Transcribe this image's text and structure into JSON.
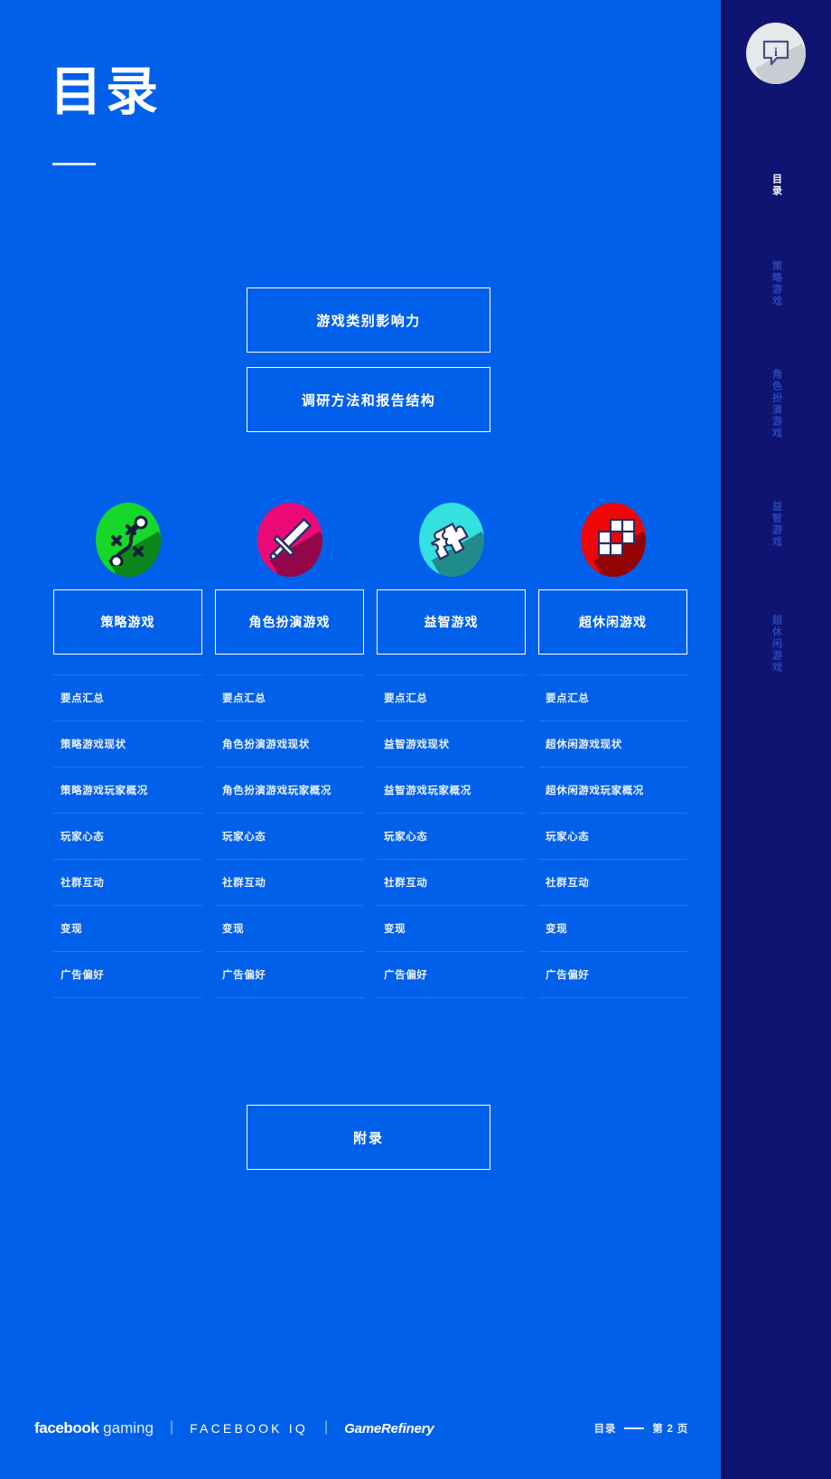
{
  "theme": {
    "background": "#0060ea",
    "sidebar_bg": "#0f1372",
    "accent_white": "#ffffff",
    "muted_nav": "#2747b4",
    "divider": "#2b72ee"
  },
  "header": {
    "title": "目录"
  },
  "sidebar": {
    "logo_icon": "info-speech-bubble-icon",
    "logo_letter": "i",
    "items": [
      {
        "label": "目录",
        "active": true
      },
      {
        "label": "策略游戏",
        "active": false
      },
      {
        "label": "角色扮演游戏",
        "active": false
      },
      {
        "label": "益智游戏",
        "active": false
      },
      {
        "label": "超休闲游戏",
        "active": false
      }
    ]
  },
  "top_buttons": [
    {
      "label": "游戏类别影响力"
    },
    {
      "label": "调研方法和报告结构"
    }
  ],
  "categories": [
    {
      "icon_name": "strategy-map-path-icon",
      "icon_color": "#16d82a",
      "title": "策略游戏",
      "items": [
        "要点汇总",
        "策略游戏现状",
        "策略游戏玩家概况",
        "玩家心态",
        "社群互动",
        "变现",
        "广告偏好"
      ]
    },
    {
      "icon_name": "rpg-sword-icon",
      "icon_color": "#ec0a78",
      "title": "角色扮演游戏",
      "items": [
        "要点汇总",
        "角色扮演游戏现状",
        "角色扮演游戏玩家概况",
        "玩家心态",
        "社群互动",
        "变现",
        "广告偏好"
      ]
    },
    {
      "icon_name": "puzzle-pieces-icon",
      "icon_color": "#34e0e0",
      "title": "益智游戏",
      "items": [
        "要点汇总",
        "益智游戏现状",
        "益智游戏玩家概况",
        "玩家心态",
        "社群互动",
        "变现",
        "广告偏好"
      ]
    },
    {
      "icon_name": "hypercasual-blocks-icon",
      "icon_color": "#ef0707",
      "title": "超休闲游戏",
      "items": [
        "要点汇总",
        "超休闲游戏现状",
        "超休闲游戏玩家概况",
        "玩家心态",
        "社群互动",
        "变现",
        "广告偏好"
      ]
    }
  ],
  "appendix": {
    "label": "附录"
  },
  "footer": {
    "brand_facebook_bold": "facebook",
    "brand_facebook_light": " gaming",
    "separator": "|",
    "brand_facebook_iq": "FACEBOOK IQ",
    "brand_gameRefinery": "GameRefinery",
    "page_section": "目录",
    "page_number": "第 2 页"
  }
}
